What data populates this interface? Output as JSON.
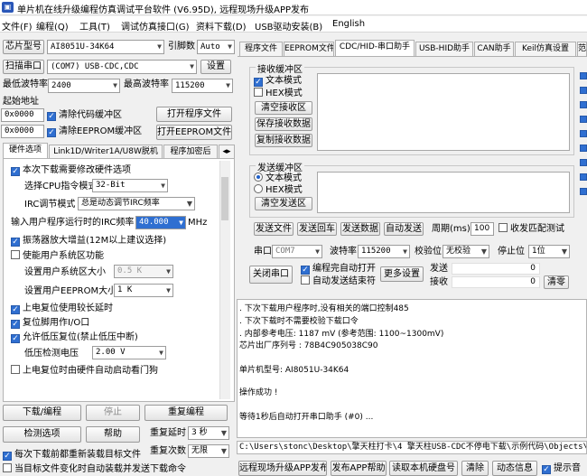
{
  "window": {
    "title": "单片机在线升级编程仿真调试平台软件 (V6.95D), 远程现场升级APP发布"
  },
  "menu": [
    "文件(F)",
    "编程(Q)",
    "工具(T)",
    "调试仿真接口(G)",
    "资料下载(D)",
    "USB驱动安装(B)",
    "English"
  ],
  "left": {
    "chip_label": "芯片型号",
    "chip_value": "AI8051U-34K64",
    "pins_label": "引脚数",
    "pins_value": "Auto",
    "scan_button": "扫描串口",
    "port_value": "(COM7) USB-CDC,CDC",
    "settings_button": "设置",
    "min_baud_label": "最低波特率",
    "min_baud_value": "2400",
    "max_baud_label": "最高波特率",
    "max_baud_value": "115200",
    "start_addr_label": "起始地址",
    "addr1": "0x0000",
    "clear_code_label": "清除代码缓冲区",
    "open_program_button": "打开程序文件",
    "addr2": "0x0000",
    "clear_eeprom_label": "清除EEPROM缓冲区",
    "open_eeprom_button": "打开EEPROM文件",
    "tabs": [
      "硬件选项",
      "Link1D/Writer1A/U8W脱机",
      "程序加密后"
    ],
    "hw": {
      "modify_opt": "本次下载需要修改硬件选项",
      "isp_label": "选择CPU指令模式",
      "isp_value": "32-Bit",
      "irc_label": "IRC调节模式",
      "irc_value": "总是动态调节IRC频率",
      "freq_label": "输入用户程序运行时的IRC频率",
      "freq_value": "40.000",
      "freq_unit": "MHz",
      "osc_gain": "振荡器放大增益(12M以上建议选择)",
      "user_eeprom": "使能用户系统区功能",
      "sys_size_label": "设置用户系统区大小",
      "sys_size_value": "0.5 K",
      "eeprom_size_label": "设置用户EEPROM大小",
      "eeprom_size_value": "1    K",
      "por_delay": "上电复位使用较长延时",
      "reset_pin": "复位脚用作I/O口",
      "lvr": "允许低压复位(禁止低压中断)",
      "lvd_label": "低压检测电压",
      "lvd_value": "2.00 V",
      "wdt": "上电复位时由硬件自动启动看门狗"
    },
    "download_button": "下载/编程",
    "stop_button": "停止",
    "reprogram_button": "重复编程",
    "check_button": "检测选项",
    "help_button": "帮助",
    "repeat_delay_label": "重复延时",
    "repeat_delay_value": "3 秒",
    "repeat_count_label": "重复次数",
    "repeat_count_value": "无限",
    "reload_each": "每次下载前都重新装载目标文件",
    "auto_reload": "当目标文件变化时自动装载并发送下载命令"
  },
  "right": {
    "tabs": [
      "程序文件",
      "EEPROM文件",
      "CDC/HID-串口助手",
      "USB-HID助手",
      "CAN助手",
      "Keil仿真设置",
      "范"
    ],
    "recv": {
      "title": "接收缓冲区",
      "text_mode": "文本模式",
      "hex_mode": "HEX模式",
      "clear_button": "清空接收区",
      "save_button": "保存接收数据",
      "copy_button": "复制接收数据"
    },
    "send": {
      "title": "发送缓冲区",
      "text_mode": "文本模式",
      "hex_mode": "HEX模式",
      "clear_button": "清空发送区"
    },
    "send_file_button": "发送文件",
    "send_enter_button": "发送回车",
    "send_data_button": "发送数据",
    "auto_send_button": "自动发送",
    "period_label": "周期(ms)",
    "period_value": "100",
    "match_label": "收发匹配测试",
    "port_label": "串口",
    "port_value": "COM7",
    "baud_label": "波特率",
    "baud_value": "115200",
    "parity_label": "校验位",
    "parity_value": "无校验",
    "stop_label": "停止位",
    "stop_value": "1位",
    "close_port_button": "关闭串口",
    "auto_open_label": "编程完自动打开",
    "auto_send_end_label": "自动发送结束符",
    "more_button": "更多设置",
    "send_count_label": "发送",
    "send_count_value": "0",
    "recv_count_label": "接收",
    "recv_count_value": "0",
    "clear_count_button": "清零"
  },
  "log": {
    "lines": [
      "  . 下次下载用户程序时,没有相关的端口控制485",
      "  . 下次下载时不需要校验下载口令",
      "  . 内部参考电压: 1187 mV (参考范围: 1100~1300mV)",
      "芯片出厂序列号 : 78B4C905038C90",
      "",
      "  单片机型号: AI8051U-34K64",
      "",
      "操作成功 !",
      "",
      "等待1秒后自动打开串口助手 (#0) ..."
    ],
    "path": "C:\\Users\\stonc\\Desktop\\擎天柱打卡\\4 擎天柱USB-CDC不停电下载\\示例代码\\Objects\\D"
  },
  "bottom": {
    "publish_button": "远程现场升级APP发布",
    "app_help_button": "发布APP帮助",
    "read_disk_button": "读取本机硬盘号",
    "clear_button": "清除",
    "dynamic_button": "动态信息",
    "tip_label": "提示音"
  }
}
